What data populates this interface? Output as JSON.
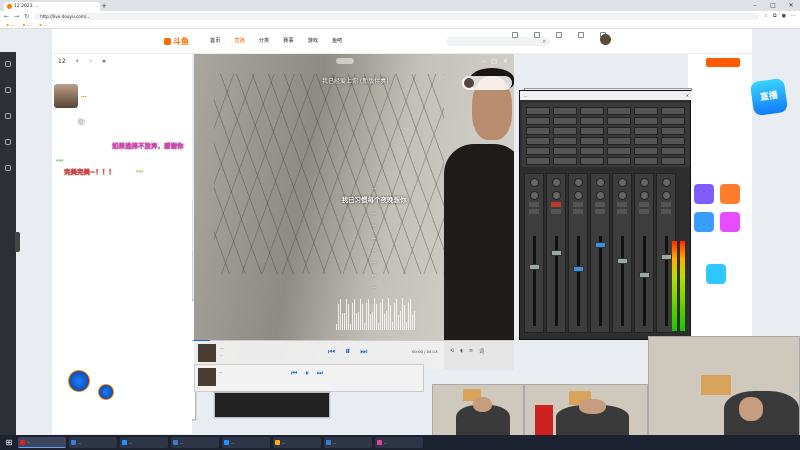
{
  "browser": {
    "tab_title": "12 2023 ...",
    "address": "http://live.douyu.com/...",
    "bookmarks": [
      "...",
      "...",
      "..."
    ]
  },
  "site": {
    "logo": "斗鱼",
    "nav": [
      "首页",
      "直播",
      "分类",
      "赛事",
      "游戏",
      "鱼吧"
    ],
    "nav_active_index": 1,
    "search_placeholder": "",
    "header_icons": [
      "",
      "",
      "",
      "",
      ""
    ]
  },
  "room": {
    "followers": "12",
    "streamer_name": "...",
    "danmu": [
      {
        "text": "哈",
        "color": "#ffffff"
      },
      {
        "text": "如果选择不放弃，感谢你",
        "color": "#ff3bd0"
      },
      {
        "text": "...",
        "color": "#3cff3c"
      },
      {
        "text": "完美完美~！！！",
        "color": "#ff3b3b"
      },
      {
        "text": "...",
        "color": "#ffd400"
      }
    ]
  },
  "player": {
    "song_title": "我已经爱上你 (新版伴奏)",
    "artist": "...",
    "lyrics": [
      "...",
      "我已习惯每个夜晚想你",
      "...",
      "...",
      "...",
      "...",
      "...",
      "...",
      "...",
      "..."
    ],
    "current_line_index": 1,
    "bar_song": "...",
    "bar_sub": "...",
    "time": "00:00 / 04:13",
    "progress": 0.05
  },
  "mixer": {
    "title": "...",
    "back_title": "..."
  },
  "right": {
    "top_button": "...",
    "promo": "直播"
  },
  "taskbar": {
    "items": [
      {
        "label": "...",
        "color": "#e02020"
      },
      {
        "label": "...",
        "color": "#3a7bd5"
      },
      {
        "label": "...",
        "color": "#1e90ff"
      },
      {
        "label": "...",
        "color": "#3a7bd5"
      },
      {
        "label": "...",
        "color": "#1e90ff"
      },
      {
        "label": "...",
        "color": "#ffb000"
      },
      {
        "label": "...",
        "color": "#3a7bd5"
      },
      {
        "label": "...",
        "color": "#e040a0"
      }
    ]
  }
}
